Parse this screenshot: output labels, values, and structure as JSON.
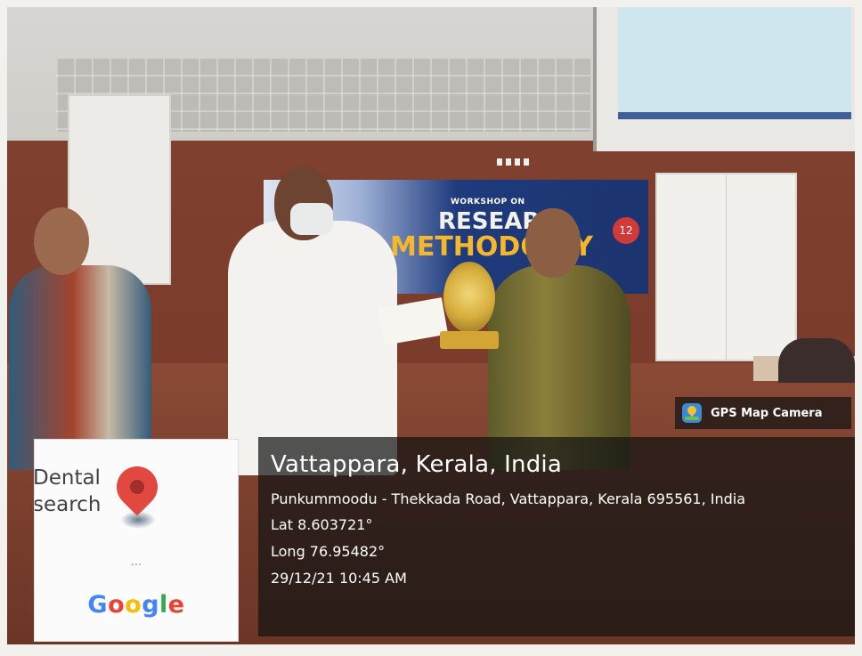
{
  "gps_badge": {
    "label": "GPS Map Camera",
    "icon": "map-pin-icon"
  },
  "location": {
    "place": "Vattappara, Kerala, India",
    "address": "Punkummoodu - Thekkada Road, Vattappara, Kerala 695561, India",
    "lat": "Lat 8.603721°",
    "long": "Long 76.95482°",
    "datetime": "29/12/21 10:45 AM"
  },
  "map_card": {
    "place_text": "Dental\nsearch",
    "ellipsis": "...",
    "logo": "Google"
  },
  "banner": {
    "line1": "WORKSHOP ON",
    "line2": "RESEARC",
    "line3": "METHODO GY",
    "badge": "12"
  },
  "colors": {
    "overlay": "#141414",
    "pin": "#e1483f",
    "google_blue": "#4285f4",
    "google_red": "#ea4335",
    "google_yellow": "#fbbc05",
    "google_green": "#34a853"
  }
}
